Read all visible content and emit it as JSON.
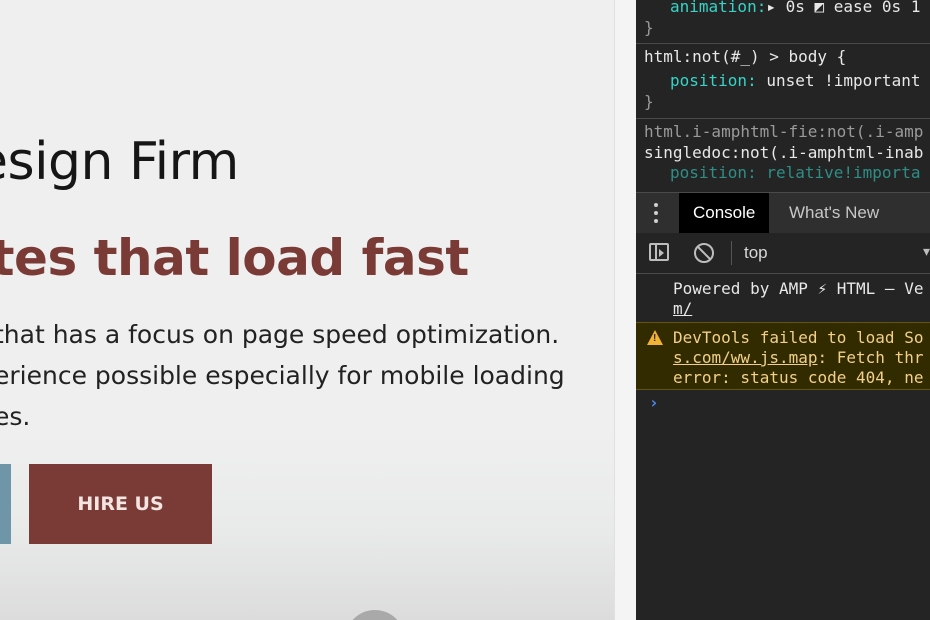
{
  "website": {
    "heading": "esign Firm",
    "tagline": "ites that load fast",
    "description_lines": [
      "that has a focus on page speed optimization.",
      "erience possible especially for mobile loading",
      "es."
    ],
    "hire_button": "HIRE US"
  },
  "devtools": {
    "styles": {
      "rule1_prop": "animation:",
      "rule1_value": "▸ 0s ◩ ease 0s 1",
      "rule1_close": "}",
      "rule2_selector": "html:not(#_) > body {",
      "rule2_prop": "position:",
      "rule2_value": " unset !important",
      "rule2_close": "}",
      "rule3_selector": "html.i-amphtml-fie:not(.i-amp",
      "rule3_selector_cont": "singledoc:not(.i-amphtml-inab",
      "rule3_partial": "position: relative!importa"
    },
    "tabs": [
      "Console",
      "What's New"
    ],
    "active_tab": "Console",
    "context_selector": "top",
    "console": {
      "log_line1": "Powered by AMP ⚡ HTML — Ve",
      "log_line2": "m/",
      "warn_line1": "DevTools failed to load So",
      "warn_link": "s.com/ww.js.map",
      "warn_line2_rest": ": Fetch thr",
      "warn_line3": "error: status code 404, ne",
      "prompt": "›"
    }
  },
  "colors": {
    "tagline": "#7a3a35",
    "hire_button_bg": "#7a3a35",
    "secondary_button_bg": "#6e95a8",
    "devtools_bg": "#242424",
    "css_property": "#35d4c7",
    "warning_bg": "#332b00",
    "prompt": "#4c8df6"
  },
  "icons": {
    "kebab": "kebab-menu-icon",
    "sidebar": "sidebar-toggle-icon",
    "clear": "clear-console-icon",
    "warning": "warning-icon",
    "dropdown": "chevron-down-icon"
  }
}
